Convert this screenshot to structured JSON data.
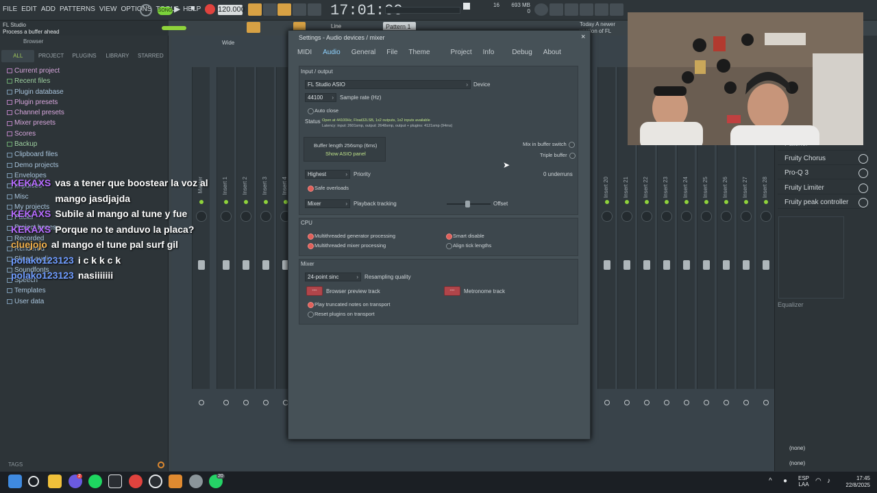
{
  "menu": [
    "FILE",
    "EDIT",
    "ADD",
    "PATTERNS",
    "VIEW",
    "OPTIONS",
    "TOOLS",
    "HELP"
  ],
  "transport": {
    "song_label": "SONG",
    "tempo": "120.000",
    "time": "17:01:00",
    "cpu": "16",
    "mem": "693 MB",
    "mem2": "0",
    "pattern": "Pattern 1",
    "snap": "Line"
  },
  "hint": {
    "title": "FL Studio",
    "text": "Process a buffer ahead"
  },
  "news": "Today  A newer version of FL Studio is available!",
  "browser": {
    "header": "Browser",
    "tabs": [
      "ALL",
      "PROJECT",
      "PLUGINS",
      "LIBRARY",
      "STARRED"
    ],
    "items": [
      {
        "label": "Current project",
        "tone": "c1"
      },
      {
        "label": "Recent files",
        "tone": "c3"
      },
      {
        "label": "Plugin database",
        "tone": "c2"
      },
      {
        "label": "Plugin presets",
        "tone": "c1"
      },
      {
        "label": "Channel presets",
        "tone": "c1"
      },
      {
        "label": "Mixer presets",
        "tone": "c1"
      },
      {
        "label": "Scores",
        "tone": "c1"
      },
      {
        "label": "Backup",
        "tone": "c3"
      },
      {
        "label": "Clipboard files",
        "tone": "c2"
      },
      {
        "label": "Demo projects",
        "tone": "c2"
      },
      {
        "label": "Envelopes",
        "tone": "c2"
      },
      {
        "label": "Impulses",
        "tone": "c2"
      },
      {
        "label": "Misc",
        "tone": "c2"
      },
      {
        "label": "My projects",
        "tone": "c2"
      },
      {
        "label": "Packs",
        "tone": "c2"
      },
      {
        "label": "Project bones",
        "tone": "c2"
      },
      {
        "label": "Recorded",
        "tone": "c2"
      },
      {
        "label": "Rendered",
        "tone": "c2"
      },
      {
        "label": "Sliced audio",
        "tone": "c2"
      },
      {
        "label": "Soundfonts",
        "tone": "c2"
      },
      {
        "label": "Speech",
        "tone": "c2"
      },
      {
        "label": "Templates",
        "tone": "c2"
      },
      {
        "label": "User data",
        "tone": "c2"
      }
    ],
    "tags_label": "TAGS"
  },
  "chat": [
    {
      "user": "KEKAXS",
      "user_color": "#b66bff",
      "text": "vas a tener que boostear la voz al mango jasdjajda"
    },
    {
      "user": "KEKAXS",
      "user_color": "#b66bff",
      "text": "Subile al mango al tune y fue"
    },
    {
      "user": "KEKAXS",
      "user_color": "#b66bff",
      "text": "Porque no te anduvo la placa?"
    },
    {
      "user": "cluejojo",
      "user_color": "#f2b04a",
      "text": "al mango el tune pal surf gil"
    },
    {
      "user": "polako123123",
      "user_color": "#6f9cff",
      "text": "i c k k c k"
    },
    {
      "user": "polako123123",
      "user_color": "#6f9cff",
      "text": "nasiiiiiii"
    }
  ],
  "mixer": {
    "strips": [
      "Master",
      "Insert 1",
      "Insert 2",
      "Insert 3",
      "Insert 4",
      "Insert 20",
      "Insert 21",
      "Insert 22",
      "Insert 23",
      "Insert 24",
      "Insert 25",
      "Insert 26",
      "Insert 27",
      "Insert 28"
    ],
    "wide_label": "Wide"
  },
  "effects": {
    "slots": [
      "Fruity Chorus",
      "Pro-Q 3",
      "Fruity Limiter",
      "Fruity peak controller"
    ],
    "partial": "Patcher",
    "eq_label": "Equalizer",
    "send1": "(none)",
    "send2": "(none)"
  },
  "dialog": {
    "title": "Settings - Audio devices / mixer",
    "tabs": [
      "MIDI",
      "Audio",
      "General",
      "File",
      "Theme",
      "Project",
      "Info",
      "Debug",
      "About"
    ],
    "active_tab": "Audio",
    "io": {
      "header": "Input / output",
      "device_value": "FL Studio ASIO",
      "device_label": "Device",
      "sample_rate_value": "44100",
      "sample_rate_label": "Sample rate (Hz)",
      "auto_close": "Auto close",
      "status_label": "Status",
      "status_line1": "Open at 44100Hz, Float32LSB, 1x2 outputs, 1x2 inputs available",
      "status_line2": "Latency: input: 2601smp, output: 2648smp, output + plugins: 4121smp (94ms)",
      "buffer_length": "Buffer length 256smp (6ms)",
      "show_asio": "Show ASIO panel",
      "mix_in_buffer": "Mix in buffer switch",
      "triple_buffer": "Triple buffer",
      "priority_value": "Highest",
      "priority_label": "Priority",
      "underruns": "0 underruns",
      "safe_overloads": "Safe overloads",
      "tracking_value": "Mixer",
      "tracking_label": "Playback tracking",
      "offset_label": "Offset"
    },
    "cpu": {
      "header": "CPU",
      "multi_gen": "Multithreaded generator processing",
      "multi_mix": "Multithreaded mixer processing",
      "smart_disable": "Smart disable",
      "align_ticks": "Align tick lengths"
    },
    "mixer": {
      "header": "Mixer",
      "resampling_value": "24-point sinc",
      "resampling_label": "Resampling quality",
      "preview_btn": "---",
      "preview_label": "Browser preview track",
      "metronome_btn": "---",
      "metronome_label": "Metronome track",
      "play_truncated": "Play truncated notes on transport",
      "reset_plugins": "Reset plugins on transport"
    }
  },
  "taskbar": {
    "lang1": "ESP",
    "lang2": "LAA",
    "time": "17:45",
    "date": "22/8/2025",
    "badge1": "2",
    "badge2": "20"
  }
}
